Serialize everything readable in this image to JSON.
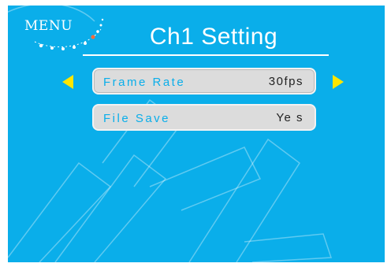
{
  "header": {
    "menu_logo_text": "MENU",
    "title": "Ch1  Setting"
  },
  "settings": [
    {
      "label": "Frame Rate",
      "value": "30fps",
      "selected": true
    },
    {
      "label": "File Save",
      "value": "Ye s",
      "selected": false
    }
  ],
  "colors": {
    "screen_background": "#0aaeea",
    "row_background": "#dcdcdc",
    "arrow": "#ffe600",
    "label_text": "#0aaeea",
    "value_text": "#222222"
  },
  "icons": {
    "left": "triangle-left-arrow-icon",
    "right": "triangle-right-arrow-icon",
    "logo": "menu-logo"
  }
}
